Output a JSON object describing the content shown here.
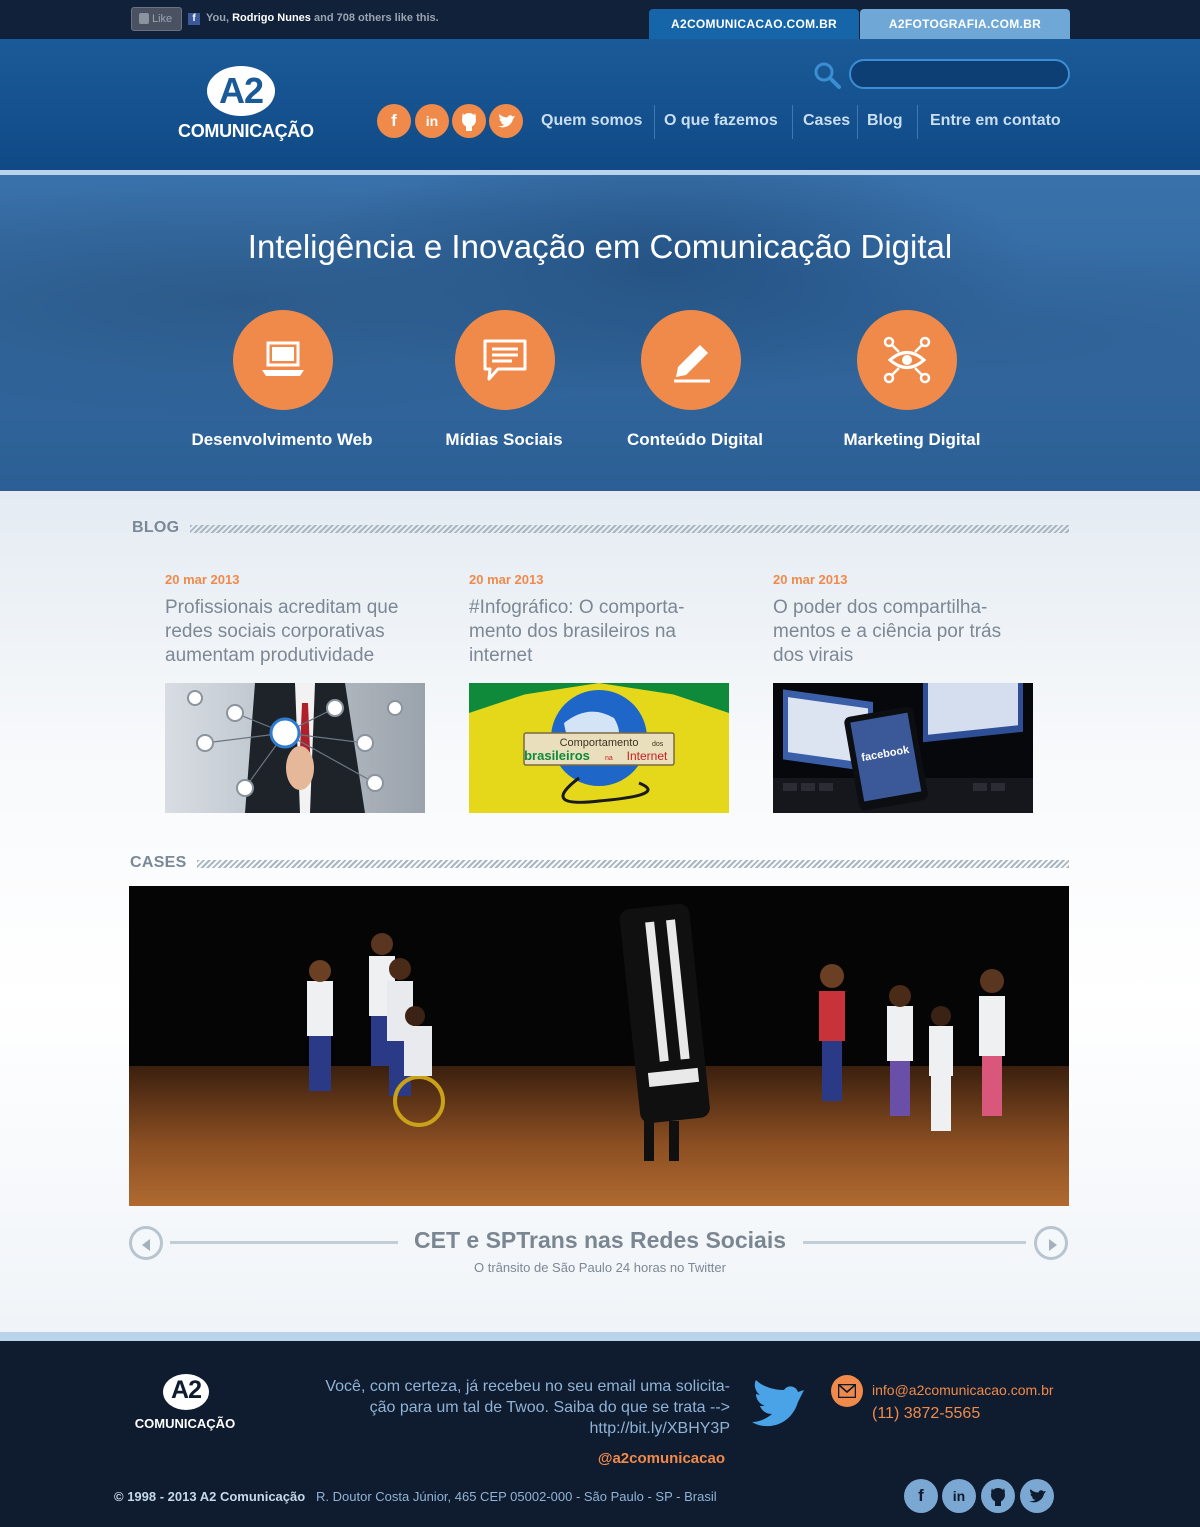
{
  "topbar": {
    "like_label": "Like",
    "like_prefix": "You,",
    "like_name": "Rodrigo Nunes",
    "like_suffix": "and 708 others like this.",
    "tabs": [
      "A2COMUNICACAO.COM.BR",
      "A2FOTOGRAFIA.COM.BR"
    ]
  },
  "header": {
    "logo_mark": "A2",
    "logo_name": "COMUNICAÇÃO",
    "search_placeholder": "",
    "social": [
      "facebook-icon",
      "linkedin-icon",
      "github-icon",
      "twitter-icon"
    ],
    "nav": [
      "Quem somos",
      "O que fazemos",
      "Cases",
      "Blog",
      "Entre em contato"
    ]
  },
  "hero": {
    "title": "Inteligência e Inovação em Comunicação Digital",
    "services": [
      {
        "label": "Desenvolvimento Web",
        "icon": "laptop-icon"
      },
      {
        "label": "Mídias Sociais",
        "icon": "chat-bubble-icon"
      },
      {
        "label": "Conteúdo Digital",
        "icon": "pencil-icon"
      },
      {
        "label": "Marketing Digital",
        "icon": "eye-network-icon"
      }
    ]
  },
  "blog": {
    "heading": "BLOG",
    "posts": [
      {
        "date": "20 mar 2013",
        "title": "Profissionais acreditam que redes sociais corporativas aumentam produtividade"
      },
      {
        "date": "20 mar 2013",
        "title": "#Infográfico: O comporta-mento dos brasileiros na internet",
        "image_text_1": "Comportamento",
        "image_text_2": "dos",
        "image_text_3": "brasileiros",
        "image_text_4": "na",
        "image_text_5": "Internet"
      },
      {
        "date": "20 mar 2013",
        "title": "O poder dos compartilha-mentos e a ciência por trás dos virais",
        "image_text": "facebook"
      }
    ]
  },
  "cases": {
    "heading": "CASES",
    "title": "CET e SPTrans nas Redes Sociais",
    "subtitle": "O trânsito de São Paulo 24 horas no Twitter"
  },
  "footer": {
    "logo_mark": "A2",
    "logo_name": "COMUNICAÇÃO",
    "tweet_lines": [
      "Você, com certeza, já recebeu no seu email uma solicita-",
      "ção para um tal de Twoo. Saiba do que se trata -->",
      "http://bit.ly/XBHY3P"
    ],
    "twitter_handle": "@a2comunicacao",
    "email": "info@a2comunicacao.com.br",
    "phone": "(11) 3872-5565",
    "copyright": "© 1998 - 2013 A2 Comunicação",
    "address": "R. Doutor Costa Júnior, 465 CEP 05002-000 - São Paulo - SP - Brasil"
  },
  "colors": {
    "accent_orange": "#f08a4b",
    "header_blue": "#1b5a98",
    "footer_navy": "#0f1b2e"
  }
}
